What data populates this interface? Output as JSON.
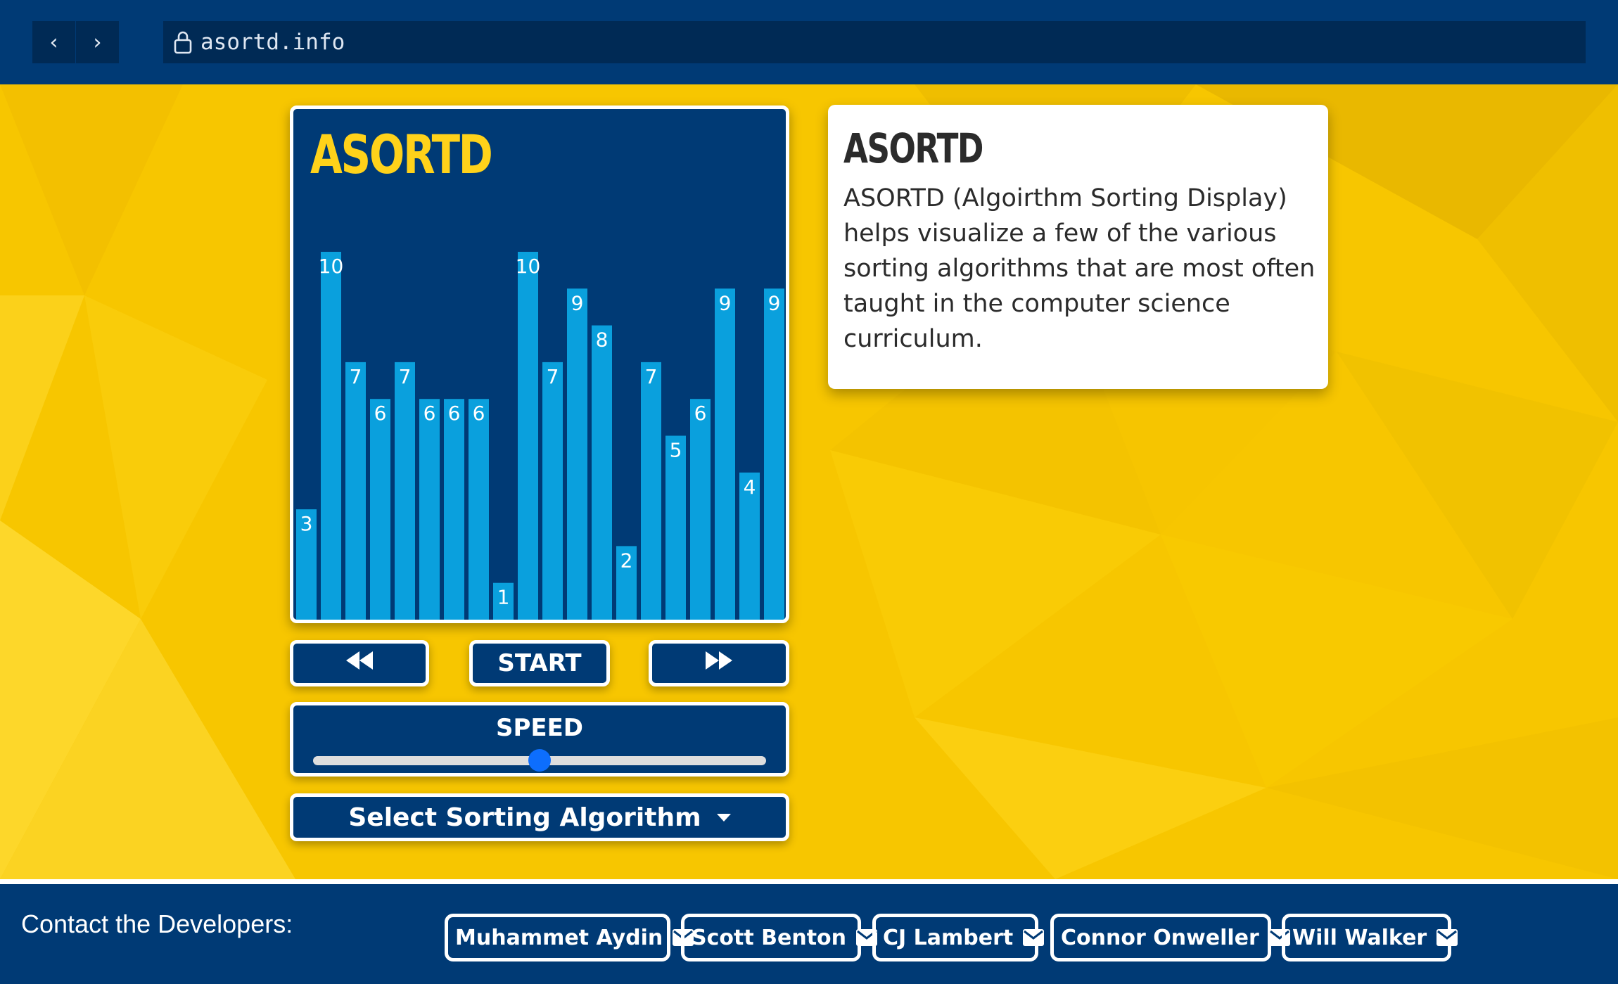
{
  "browser": {
    "url": "asortd.info",
    "back_glyph": "‹",
    "forward_glyph": "›"
  },
  "app": {
    "title": "ASORTD"
  },
  "chart_data": {
    "type": "bar",
    "values": [
      3,
      10,
      7,
      6,
      7,
      6,
      6,
      6,
      1,
      10,
      7,
      9,
      8,
      2,
      7,
      5,
      6,
      9,
      4,
      9
    ],
    "ylim": [
      0,
      10
    ]
  },
  "controls": {
    "back_label": "⏪",
    "start_label": "START",
    "forward_label": "⏩",
    "speed_label": "SPEED",
    "speed_value": 0.5,
    "algorithm_select_label": "Select Sorting Algorithm"
  },
  "info": {
    "title": "ASORTD",
    "text": "ASORTD (Algoirthm Sorting Display) helps visualize a few of the various sorting algorithms that are most often taught in the computer science curriculum."
  },
  "footer": {
    "label": "Contact the Developers:",
    "developers": [
      "Muhammet Aydin",
      "Scott Benton",
      "CJ Lambert",
      "Connor Onweller",
      "Will Walker"
    ]
  },
  "colors": {
    "navy": "#003a75",
    "bar": "#0aa0dd",
    "title_yellow": "#ffd21a",
    "background_yellow": "#f5c400",
    "slider_thumb": "#0d6efd"
  }
}
